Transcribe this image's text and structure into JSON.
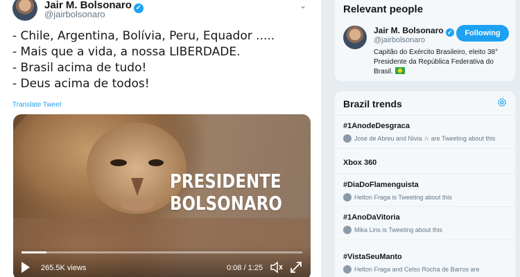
{
  "tweet": {
    "author_name": "Jair M. Bolsonaro",
    "author_handle": "@jairbolsonaro",
    "lines": [
      "- Chile, Argentina, Bolívia, Peru, Equador .....",
      "- Mais que a vida, a nossa LIBERDADE.",
      "- Brasil acima de tudo!",
      "- Deus acima de todos!"
    ],
    "translate_label": "Translate Tweet",
    "video": {
      "overlay_line1": "PRESIDENTE",
      "overlay_line2": "BOLSONARO",
      "views": "265.5K views",
      "time": "0:08 / 1:25",
      "progress": 0.09
    }
  },
  "sidebar": {
    "relevant_people": {
      "title": "Relevant people",
      "person": {
        "name": "Jair M. Bolsonaro",
        "handle": "@jairbolsonaro",
        "follow_label": "Following",
        "bio": "Capitão do Exército Brasileiro, eleito 38° Presidente da República Federativa do Brasil."
      }
    },
    "trends": {
      "title": "Brazil trends",
      "items": [
        {
          "name": "#1AnodeDesgraca",
          "sub": "Jose de Abreu and Nivia ☆ are Tweeting about this"
        },
        {
          "name": "Xbox 360",
          "sub": ""
        },
        {
          "name": "#DiaDoFlamenguista",
          "sub": "Helton Fraga is Tweeting about this"
        },
        {
          "name": "#1AnoDaVitoria",
          "sub": "Mika Lins is Tweeting about this"
        },
        {
          "name": "#VistaSeuManto",
          "sub": "Helton Fraga and Celso Rocha de Barros are"
        }
      ]
    }
  },
  "colors": {
    "accent": "#1da1f2",
    "text": "#14171a",
    "muted": "#657786",
    "background": "#e6ecf0"
  }
}
